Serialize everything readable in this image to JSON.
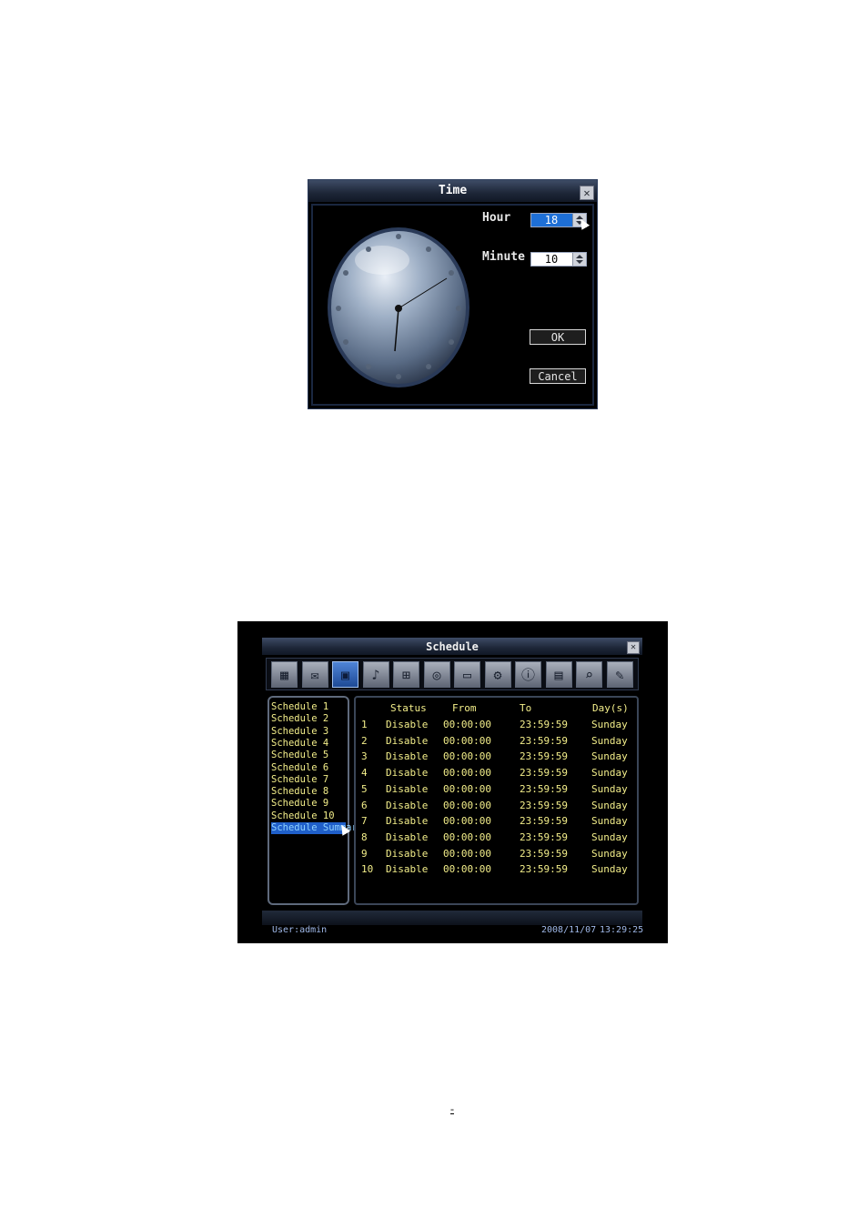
{
  "time_dialog": {
    "title": "Time",
    "hour_label": "Hour",
    "hour_value": "18",
    "minute_label": "Minute",
    "minute_value": "10",
    "ok_label": "OK",
    "cancel_label": "Cancel",
    "close_icon": "close-icon",
    "clock_icon": "analog-clock-icon"
  },
  "schedule_window": {
    "title": "Schedule",
    "close_icon": "close-icon",
    "toolbar_icons": [
      "film-icon",
      "envelope-icon",
      "schedule-icon",
      "bell-icon",
      "network-icon",
      "disk-icon",
      "monitor-icon",
      "gear-icon",
      "info-icon",
      "log-icon",
      "search-icon",
      "tools-icon"
    ],
    "active_toolbar_index": 2,
    "schedules": [
      "Schedule 1",
      "Schedule 2",
      "Schedule 3",
      "Schedule 4",
      "Schedule 5",
      "Schedule 6",
      "Schedule 7",
      "Schedule 8",
      "Schedule 9",
      "Schedule 10",
      "Schedule Summary"
    ],
    "selected_schedule_index": 10,
    "columns": [
      "Status",
      "From",
      "To",
      "Day(s)"
    ],
    "rows": [
      {
        "num": "1",
        "status": "Disable",
        "from": "00:00:00",
        "to": "23:59:59",
        "days": "Sunday"
      },
      {
        "num": "2",
        "status": "Disable",
        "from": "00:00:00",
        "to": "23:59:59",
        "days": "Sunday"
      },
      {
        "num": "3",
        "status": "Disable",
        "from": "00:00:00",
        "to": "23:59:59",
        "days": "Sunday"
      },
      {
        "num": "4",
        "status": "Disable",
        "from": "00:00:00",
        "to": "23:59:59",
        "days": "Sunday"
      },
      {
        "num": "5",
        "status": "Disable",
        "from": "00:00:00",
        "to": "23:59:59",
        "days": "Sunday"
      },
      {
        "num": "6",
        "status": "Disable",
        "from": "00:00:00",
        "to": "23:59:59",
        "days": "Sunday"
      },
      {
        "num": "7",
        "status": "Disable",
        "from": "00:00:00",
        "to": "23:59:59",
        "days": "Sunday"
      },
      {
        "num": "8",
        "status": "Disable",
        "from": "00:00:00",
        "to": "23:59:59",
        "days": "Sunday"
      },
      {
        "num": "9",
        "status": "Disable",
        "from": "00:00:00",
        "to": "23:59:59",
        "days": "Sunday"
      },
      {
        "num": "10",
        "status": "Disable",
        "from": "00:00:00",
        "to": "23:59:59",
        "days": "Sunday"
      }
    ],
    "user_text": "User:admin",
    "date_text": "2008/11/07",
    "time_text": "13:29:25"
  },
  "page_number": "-"
}
